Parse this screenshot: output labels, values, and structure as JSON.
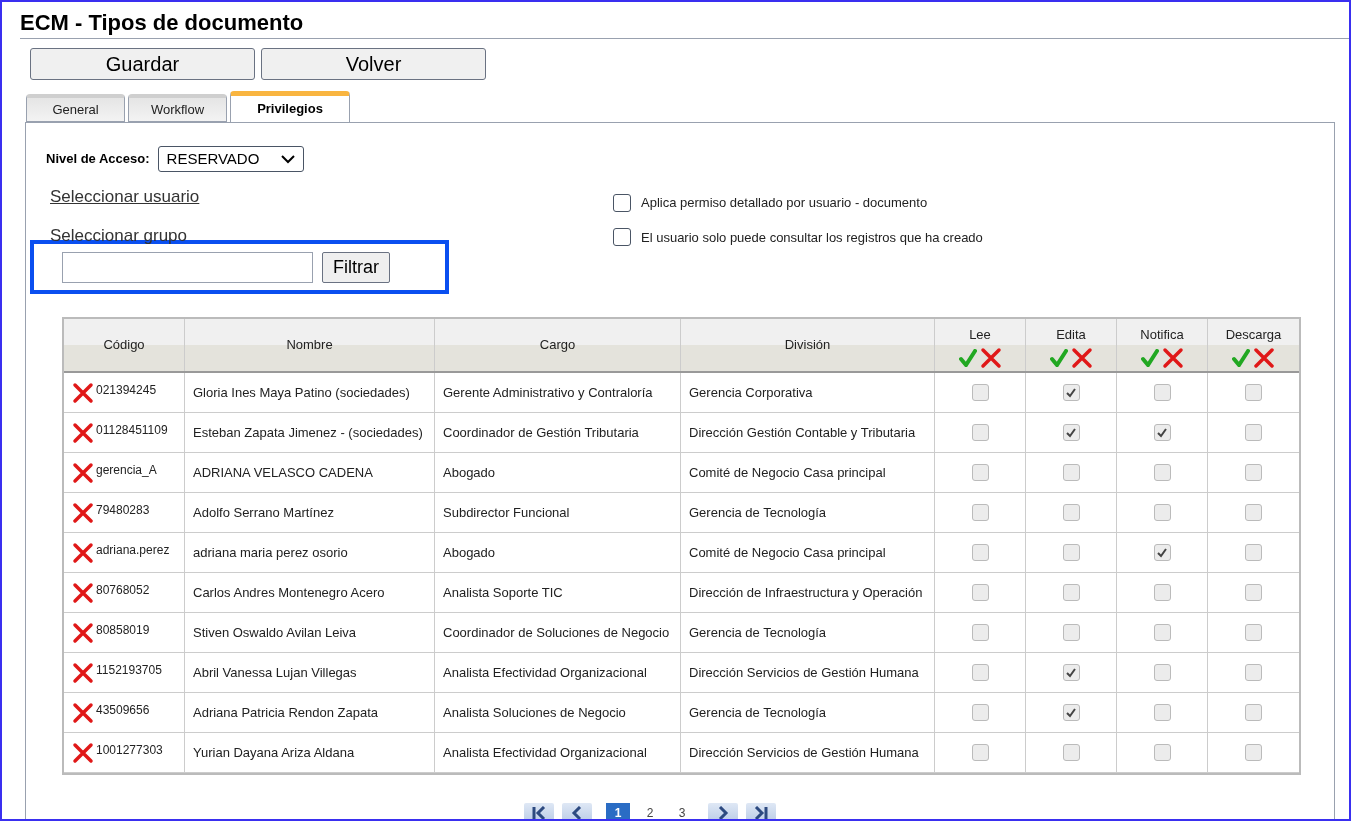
{
  "title": "ECM - Tipos de documento",
  "buttons": [
    "Guardar",
    "Volver"
  ],
  "tabs": [
    {
      "label": "General",
      "selected": false
    },
    {
      "label": "Workflow",
      "selected": false
    },
    {
      "label": "Privilegios",
      "selected": true
    }
  ],
  "access_level": {
    "label": "Nivel de Acceso:",
    "value": "RESERVADO"
  },
  "links": [
    "Seleccionar usuario",
    "Seleccionar grupo"
  ],
  "filter": {
    "button": "Filtrar"
  },
  "options": [
    {
      "label": "Aplica permiso detallado por usuario - documento",
      "checked": false
    },
    {
      "label": "El usuario solo puede consultar los registros que ha creado",
      "checked": false
    }
  ],
  "table": {
    "columns": [
      "Código",
      "Nombre",
      "Cargo",
      "División"
    ],
    "permission_columns": [
      "Lee",
      "Edita",
      "Notifica",
      "Descarga"
    ],
    "rows": [
      {
        "code": "021394245",
        "name": "Gloria Ines Maya Patino (sociedades)",
        "role": "Gerente Administrativo y Contraloría",
        "division": "Gerencia Corporativa",
        "permissions": [
          false,
          true,
          false,
          false
        ]
      },
      {
        "code": "01128451109",
        "name": "Esteban Zapata Jimenez - (sociedades)",
        "role": "Coordinador de Gestión Tributaria",
        "division": "Dirección Gestión Contable y Tributaria",
        "permissions": [
          false,
          true,
          true,
          false
        ]
      },
      {
        "code": "gerencia_A",
        "name": "ADRIANA VELASCO CADENA",
        "role": "Abogado",
        "division": "Comité de Negocio Casa principal",
        "permissions": [
          false,
          false,
          false,
          false
        ]
      },
      {
        "code": "79480283",
        "name": "Adolfo Serrano Martínez",
        "role": "Subdirector Funcional",
        "division": "Gerencia de Tecnología",
        "permissions": [
          false,
          false,
          false,
          false
        ]
      },
      {
        "code": "adriana.perez",
        "name": "adriana maria perez osorio",
        "role": "Abogado",
        "division": "Comité de Negocio Casa principal",
        "permissions": [
          false,
          false,
          true,
          false
        ]
      },
      {
        "code": "80768052",
        "name": "Carlos Andres Montenegro Acero",
        "role": "Analista Soporte TIC",
        "division": "Dirección de Infraestructura y Operación",
        "permissions": [
          false,
          false,
          false,
          false
        ]
      },
      {
        "code": "80858019",
        "name": "Stiven Oswaldo Avilan Leiva",
        "role": "Coordinador de Soluciones de Negocio",
        "division": "Gerencia de Tecnología",
        "permissions": [
          false,
          false,
          false,
          false
        ]
      },
      {
        "code": "1152193705",
        "name": "Abril Vanessa Lujan Villegas",
        "role": "Analista Efectividad Organizacional",
        "division": "Dirección Servicios de Gestión Humana",
        "permissions": [
          false,
          true,
          false,
          false
        ]
      },
      {
        "code": "43509656",
        "name": "Adriana Patricia Rendon Zapata",
        "role": "Analista Soluciones de Negocio",
        "division": "Gerencia de Tecnología",
        "permissions": [
          false,
          true,
          false,
          false
        ]
      },
      {
        "code": "1001277303",
        "name": "Yurian Dayana Ariza Aldana",
        "role": "Analista Efectividad Organizacional",
        "division": "Dirección Servicios de Gestión Humana",
        "permissions": [
          false,
          false,
          false,
          false
        ]
      }
    ]
  },
  "pagination": [
    {
      "label": "1",
      "selected": true
    },
    {
      "label": "2",
      "selected": false
    },
    {
      "label": "3",
      "selected": false
    }
  ]
}
